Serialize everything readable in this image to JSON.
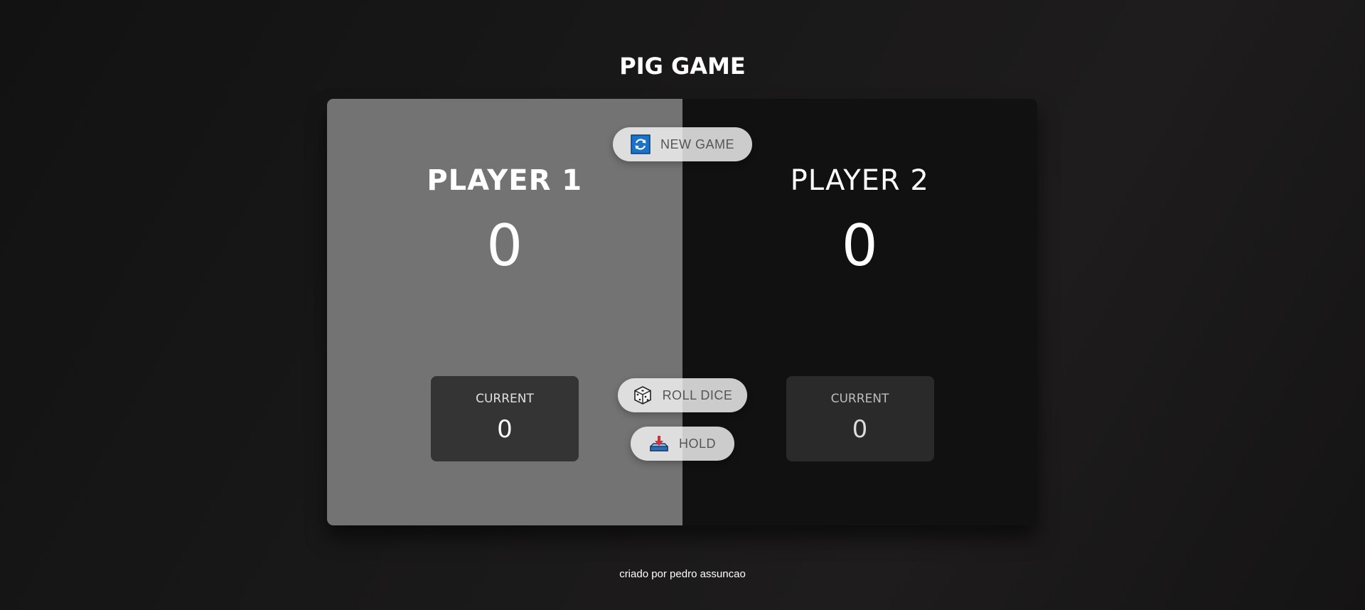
{
  "title": "PIG GAME",
  "players": [
    {
      "name": "PLAYER 1",
      "score": "0",
      "current_label": "CURRENT",
      "current": "0",
      "active": true
    },
    {
      "name": "PLAYER 2",
      "score": "0",
      "current_label": "CURRENT",
      "current": "0",
      "active": false
    }
  ],
  "buttons": {
    "new_game": {
      "label": "NEW GAME",
      "icon": "refresh-icon"
    },
    "roll_dice": {
      "label": "ROLL DICE",
      "icon": "dice-icon"
    },
    "hold": {
      "label": "HOLD",
      "icon": "download-tray-icon"
    }
  },
  "footer": "criado por pedro assuncao",
  "colors": {
    "active_panel": "#737373",
    "inactive_panel": "#111111",
    "background": "#1a1919"
  }
}
